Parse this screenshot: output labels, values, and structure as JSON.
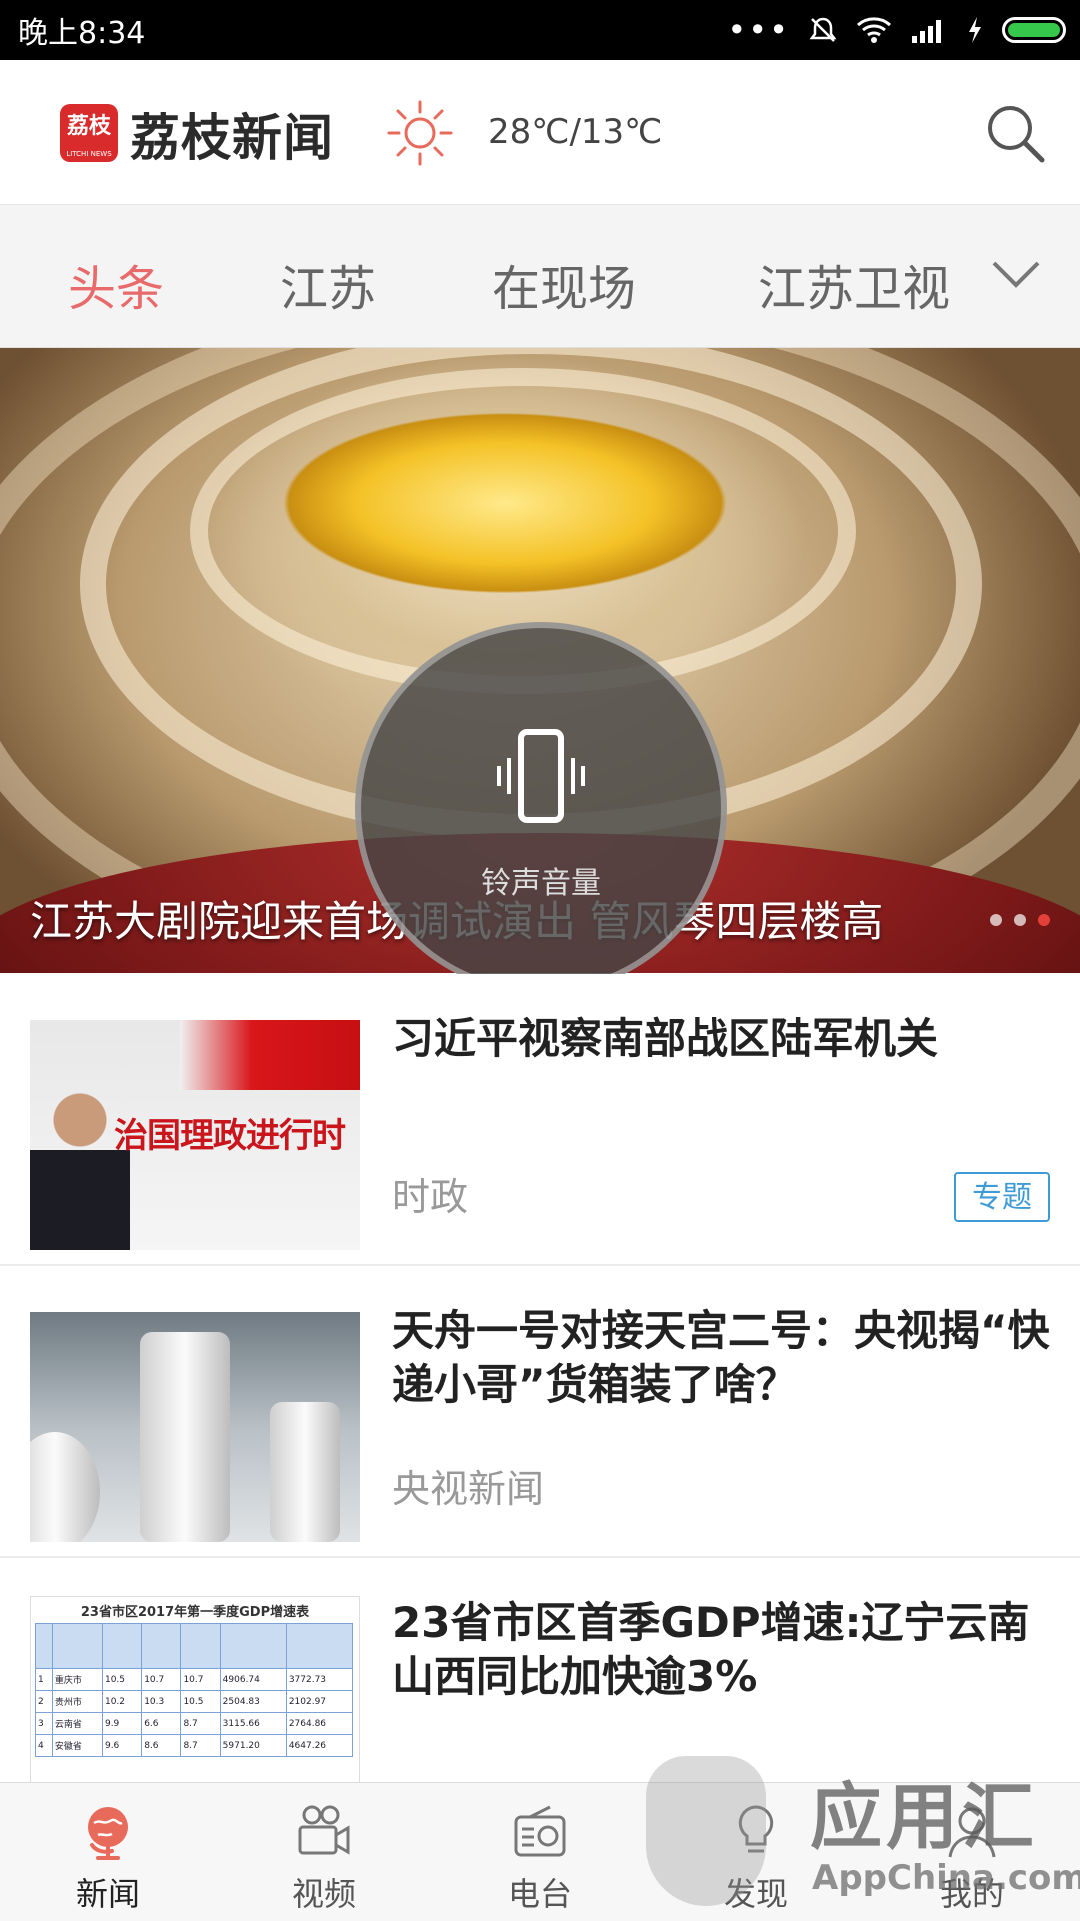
{
  "status_bar": {
    "time": "晚上8:34",
    "dots": "•••"
  },
  "header": {
    "logo_text": "荔枝",
    "logo_sub": "LITCHI NEWS",
    "title": "荔枝新闻",
    "weather_icon": "sun-icon",
    "temperature": "28℃/13℃"
  },
  "tabs": [
    {
      "label": "头条",
      "active": true
    },
    {
      "label": "江苏",
      "active": false
    },
    {
      "label": "在现场",
      "active": false
    },
    {
      "label": "江苏卫视",
      "active": false
    }
  ],
  "hero": {
    "caption": "江苏大剧院迎来首场调试演出 管风琴四层楼高",
    "pages": 3,
    "current_page": 3
  },
  "volume_overlay": {
    "label": "铃声音量",
    "icon": "phone-vibrate-icon"
  },
  "news": [
    {
      "title": "习近平视察南部战区陆军机关",
      "source": "时政",
      "badge": "专题",
      "thumb_text": "治国理政进行时"
    },
    {
      "title": "天舟一号对接天宫二号：央视揭“快递小哥”货箱装了啥？",
      "source": "央视新闻"
    },
    {
      "title": "23省市区首季GDP增速:辽宁云南山西同比加快逾3%",
      "source": "",
      "thumb_title": "23省市区2017年第一季度GDP增速表",
      "thumb_rows": [
        [
          "1",
          "重庆市",
          "10.5",
          "10.7",
          "10.7",
          "4906.74",
          "3772.73"
        ],
        [
          "2",
          "贵州市",
          "10.2",
          "10.3",
          "10.5",
          "2504.83",
          "2102.97"
        ],
        [
          "3",
          "云南省",
          "9.9",
          "6.6",
          "8.7",
          "3115.66",
          "2764.86"
        ],
        [
          "4",
          "安徽省",
          "9.6",
          "8.6",
          "8.7",
          "5971.20",
          "4647.26"
        ]
      ]
    }
  ],
  "bottom_nav": [
    {
      "label": "新闻",
      "icon": "globe-icon",
      "active": true
    },
    {
      "label": "视频",
      "icon": "video-camera-icon",
      "active": false
    },
    {
      "label": "电台",
      "icon": "radio-icon",
      "active": false
    },
    {
      "label": "发现",
      "icon": "lightbulb-icon",
      "active": false
    },
    {
      "label": "我的",
      "icon": "user-icon",
      "active": false
    }
  ],
  "watermark": {
    "text": "应用汇",
    "sub": "AppChina.com"
  },
  "colors": {
    "accent": "#e86a6a",
    "badge": "#3f9bd6",
    "logo": "#d92b2b"
  }
}
